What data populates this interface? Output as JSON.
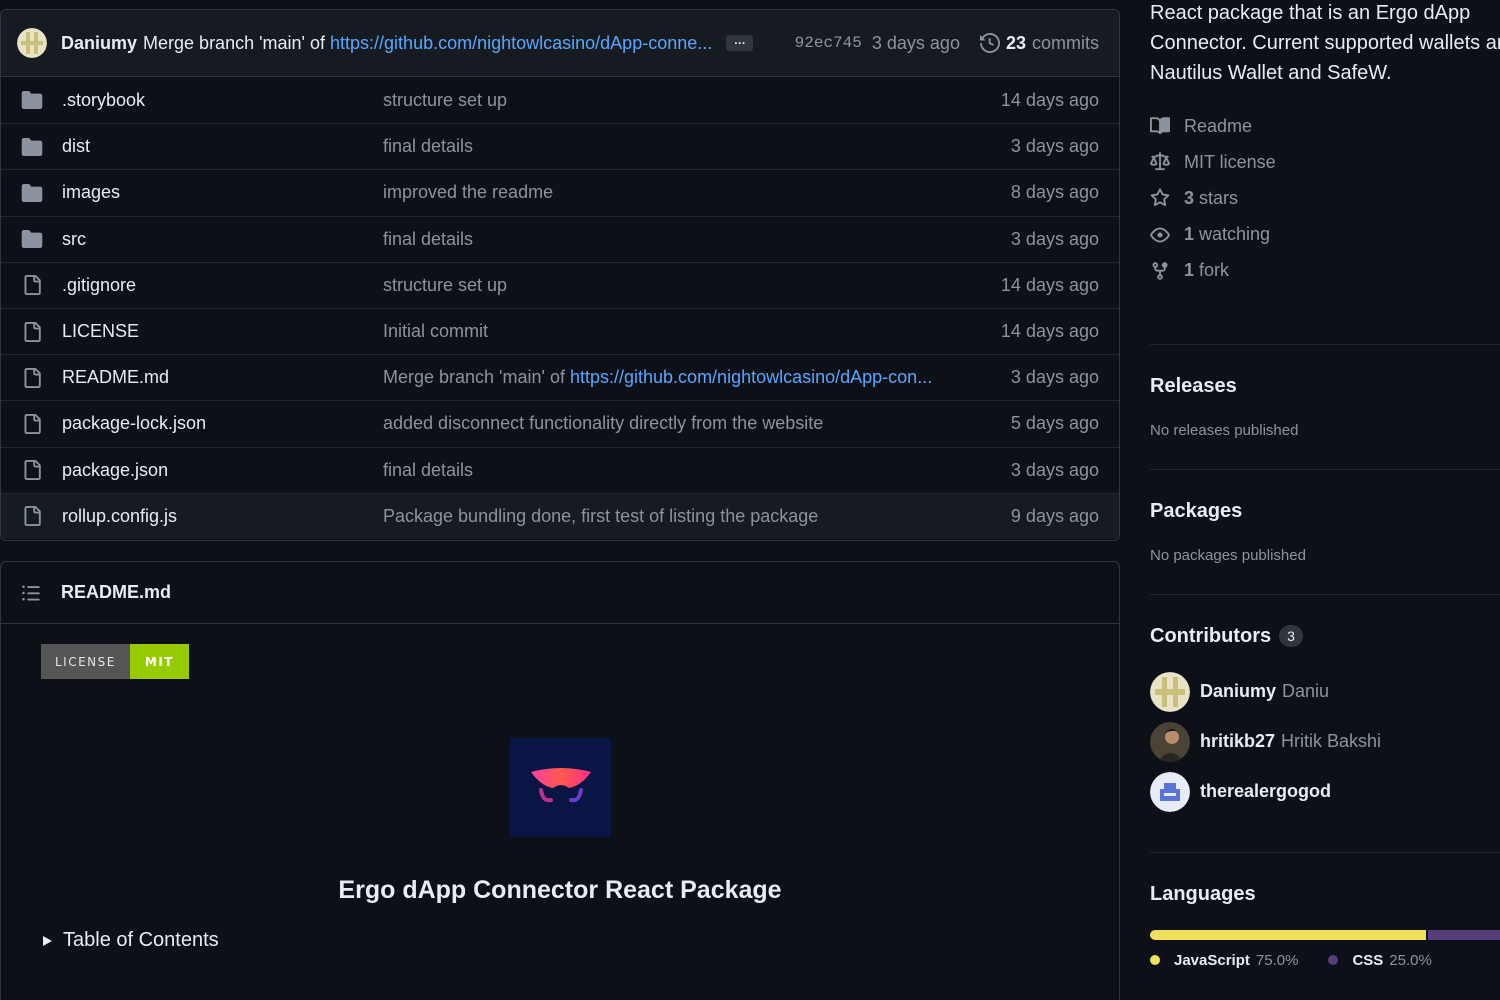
{
  "latest_commit": {
    "author": "Daniumy",
    "message_prefix": "Merge branch 'main' of",
    "message_link": "https://github.com/nightowlcasino/dApp-conne...",
    "sha": "92ec745",
    "age": "3 days ago",
    "commit_count": "23",
    "commits_label": "commits"
  },
  "files": [
    {
      "name": ".storybook",
      "type": "folder",
      "commit": "structure set up",
      "age": "14 days ago"
    },
    {
      "name": "dist",
      "type": "folder",
      "commit": "final details",
      "age": "3 days ago"
    },
    {
      "name": "images",
      "type": "folder",
      "commit": "improved the readme",
      "age": "8 days ago"
    },
    {
      "name": "src",
      "type": "folder",
      "commit": "final details",
      "age": "3 days ago"
    },
    {
      "name": ".gitignore",
      "type": "file",
      "commit": "structure set up",
      "age": "14 days ago"
    },
    {
      "name": "LICENSE",
      "type": "file",
      "commit": "Initial commit",
      "age": "14 days ago"
    },
    {
      "name": "README.md",
      "type": "file",
      "commit": "Merge branch 'main' of",
      "commit_link": "https://github.com/nightowlcasino/dApp-con...",
      "age": "3 days ago"
    },
    {
      "name": "package-lock.json",
      "type": "file",
      "commit": "added disconnect functionality directly from the website",
      "age": "5 days ago"
    },
    {
      "name": "package.json",
      "type": "file",
      "commit": "final details",
      "age": "3 days ago"
    },
    {
      "name": "rollup.config.js",
      "type": "file",
      "commit": "Package bundling done, first test of listing the package",
      "age": "9 days ago"
    }
  ],
  "readme": {
    "header": "README.md",
    "badge_left": "LICENSE",
    "badge_right": "MIT",
    "heading": "Ergo dApp Connector React Package",
    "toc": "Table of Contents"
  },
  "sidebar": {
    "about_lines": [
      "React package that is an Ergo dApp",
      "Connector. Current supported wallets ar",
      "Nautilus Wallet and SafeW."
    ],
    "meta": [
      {
        "icon": "book-icon",
        "count": "",
        "label": "Readme"
      },
      {
        "icon": "scale-icon",
        "count": "",
        "label": "MIT license"
      },
      {
        "icon": "star-icon",
        "count": "3",
        "label": "stars"
      },
      {
        "icon": "eye-icon",
        "count": "1",
        "label": "watching"
      },
      {
        "icon": "fork-icon",
        "count": "1",
        "label": "fork"
      }
    ],
    "releases_title": "Releases",
    "releases_empty": "No releases published",
    "packages_title": "Packages",
    "packages_empty": "No packages published",
    "contributors_title": "Contributors",
    "contributors_count": "3",
    "contributors": [
      {
        "login": "Daniumy",
        "name": "Daniu"
      },
      {
        "login": "hritikb27",
        "name": "Hritik Bakshi"
      },
      {
        "login": "therealergogod",
        "name": ""
      }
    ],
    "languages_title": "Languages",
    "languages": [
      {
        "name": "JavaScript",
        "percent": "75.0%",
        "value": 75.0,
        "color": "#f1e05a"
      },
      {
        "name": "CSS",
        "percent": "25.0%",
        "value": 25.0,
        "color": "#563d7c"
      }
    ]
  }
}
